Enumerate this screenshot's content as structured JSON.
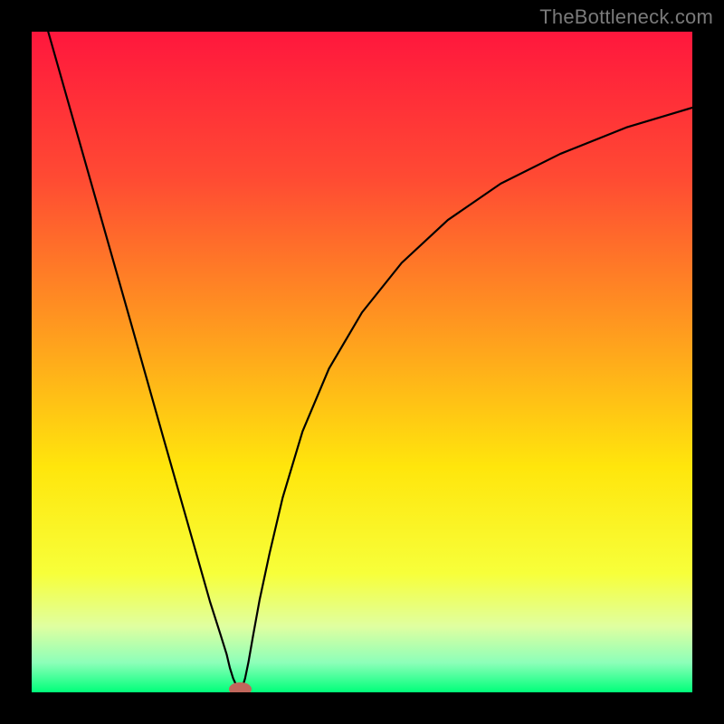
{
  "watermark": "TheBottleneck.com",
  "chart_data": {
    "type": "line",
    "title": "",
    "xlabel": "",
    "ylabel": "",
    "xlim": [
      0,
      1
    ],
    "ylim": [
      0,
      1
    ],
    "grid": false,
    "legend": false,
    "gradient_stops": [
      {
        "offset": 0.0,
        "color": "#ff173d"
      },
      {
        "offset": 0.22,
        "color": "#ff4a33"
      },
      {
        "offset": 0.45,
        "color": "#ff9a1f"
      },
      {
        "offset": 0.66,
        "color": "#ffe60c"
      },
      {
        "offset": 0.82,
        "color": "#f7ff3a"
      },
      {
        "offset": 0.9,
        "color": "#e0ffa0"
      },
      {
        "offset": 0.955,
        "color": "#8dffb9"
      },
      {
        "offset": 1.0,
        "color": "#00ff7a"
      }
    ],
    "series": [
      {
        "name": "bottleneck-curve",
        "type": "line",
        "color": "#000000",
        "x": [
          0.025,
          0.05,
          0.1,
          0.15,
          0.2,
          0.245,
          0.27,
          0.285,
          0.295,
          0.3,
          0.305,
          0.311,
          0.3155,
          0.319,
          0.323,
          0.328,
          0.335,
          0.345,
          0.36,
          0.38,
          0.41,
          0.45,
          0.5,
          0.56,
          0.63,
          0.71,
          0.8,
          0.9,
          1.0
        ],
        "y": [
          1.0,
          0.912,
          0.736,
          0.56,
          0.383,
          0.225,
          0.137,
          0.09,
          0.058,
          0.037,
          0.021,
          0.008,
          0.003,
          0.008,
          0.021,
          0.045,
          0.085,
          0.14,
          0.21,
          0.295,
          0.395,
          0.49,
          0.575,
          0.65,
          0.715,
          0.77,
          0.815,
          0.855,
          0.885
        ]
      }
    ],
    "marker": {
      "x": 0.3155,
      "y": 0.005,
      "rx": 0.017,
      "ry": 0.01,
      "color": "#c1675c"
    }
  }
}
